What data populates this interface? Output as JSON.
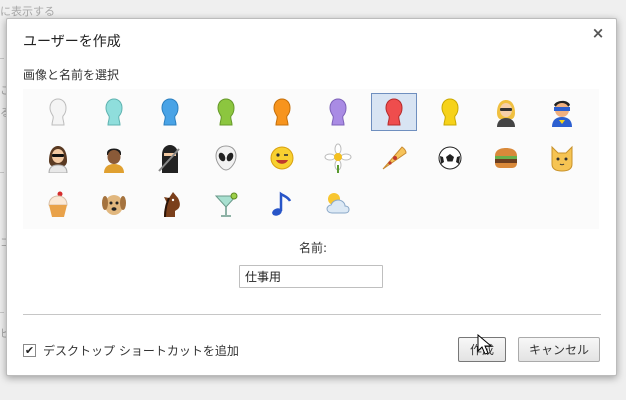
{
  "background": {
    "texts": [
      "に表示する",
      "こ",
      "る",
      "コ",
      "ピ"
    ]
  },
  "dialog": {
    "title": "ユーザーを作成",
    "close_label": "×",
    "subtitle": "画像と名前を選択",
    "avatars": [
      {
        "name": "white-user-avatar",
        "color": "#f4f4f4"
      },
      {
        "name": "cyan-user-avatar",
        "color": "#8fdedc"
      },
      {
        "name": "blue-user-avatar",
        "color": "#49a3e6"
      },
      {
        "name": "green-user-avatar",
        "color": "#8cc63f"
      },
      {
        "name": "orange-user-avatar",
        "color": "#f7941d"
      },
      {
        "name": "purple-user-avatar",
        "color": "#a98be4"
      },
      {
        "name": "red-user-avatar",
        "color": "#ef4d4d",
        "selected": true
      },
      {
        "name": "yellow-user-avatar",
        "color": "#f6d21a"
      },
      {
        "name": "businesswoman-avatar"
      },
      {
        "name": "superhero-avatar"
      },
      {
        "name": "woman-sunglasses-avatar"
      },
      {
        "name": "man-avatar"
      },
      {
        "name": "ninja-avatar"
      },
      {
        "name": "alien-avatar"
      },
      {
        "name": "smiley-avatar"
      },
      {
        "name": "flower-avatar"
      },
      {
        "name": "pizza-avatar"
      },
      {
        "name": "soccer-ball-avatar"
      },
      {
        "name": "burger-avatar"
      },
      {
        "name": "cat-avatar"
      },
      {
        "name": "cupcake-avatar"
      },
      {
        "name": "dog-avatar"
      },
      {
        "name": "horse-avatar"
      },
      {
        "name": "cocktail-avatar"
      },
      {
        "name": "music-note-avatar"
      },
      {
        "name": "sun-cloud-avatar"
      }
    ],
    "name_label": "名前:",
    "name_value": "仕事用",
    "shortcut_checked": true,
    "shortcut_label": "デスクトップ ショートカットを追加",
    "create_button": "作成",
    "cancel_button": "キャンセル"
  }
}
